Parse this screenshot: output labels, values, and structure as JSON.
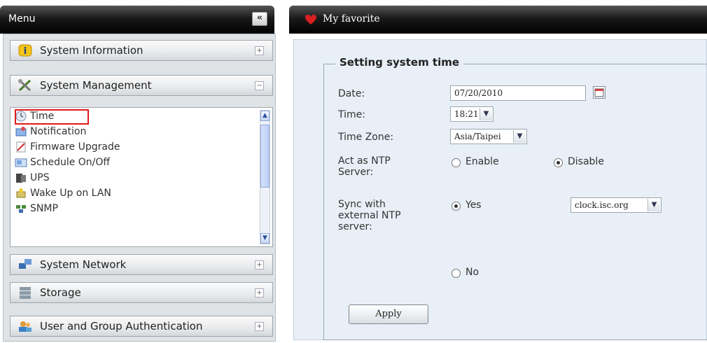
{
  "menu": {
    "title": "Menu",
    "collapse_label": "«",
    "categories": {
      "system_information": "System Information",
      "system_management": "System Management",
      "system_network": "System Network",
      "storage": "Storage",
      "user_group_auth": "User and Group Authentication"
    },
    "expand_symbol": "+",
    "collapse_symbol": "−",
    "sub_items": [
      "Time",
      "Notification",
      "Firmware Upgrade",
      "Schedule On/Off",
      "UPS",
      "Wake Up on LAN",
      "SNMP"
    ],
    "selected_item": "Time"
  },
  "header": {
    "favorite_label": "My favorite"
  },
  "form": {
    "legend": "Setting system time",
    "date_label": "Date:",
    "date_value": "07/20/2010",
    "time_label": "Time:",
    "time_value": "18:21",
    "tz_label": "Time Zone:",
    "tz_value": "Asia/Taipei",
    "ntp_server_label_1": "Act as NTP",
    "ntp_server_label_2": "Server:",
    "enable_label": "Enable",
    "disable_label": "Disable",
    "ntp_server_selected": "Disable",
    "sync_label_1": "Sync with",
    "sync_label_2": "external NTP",
    "sync_label_3": "server:",
    "yes_label": "Yes",
    "no_label": "No",
    "sync_selected": "Yes",
    "ntp_host_value": "clock.isc.org",
    "apply_label": "Apply"
  },
  "colors": {
    "highlight": "#e01a1a",
    "content_bg": "#e8eff6",
    "header_bg": "#000000"
  }
}
